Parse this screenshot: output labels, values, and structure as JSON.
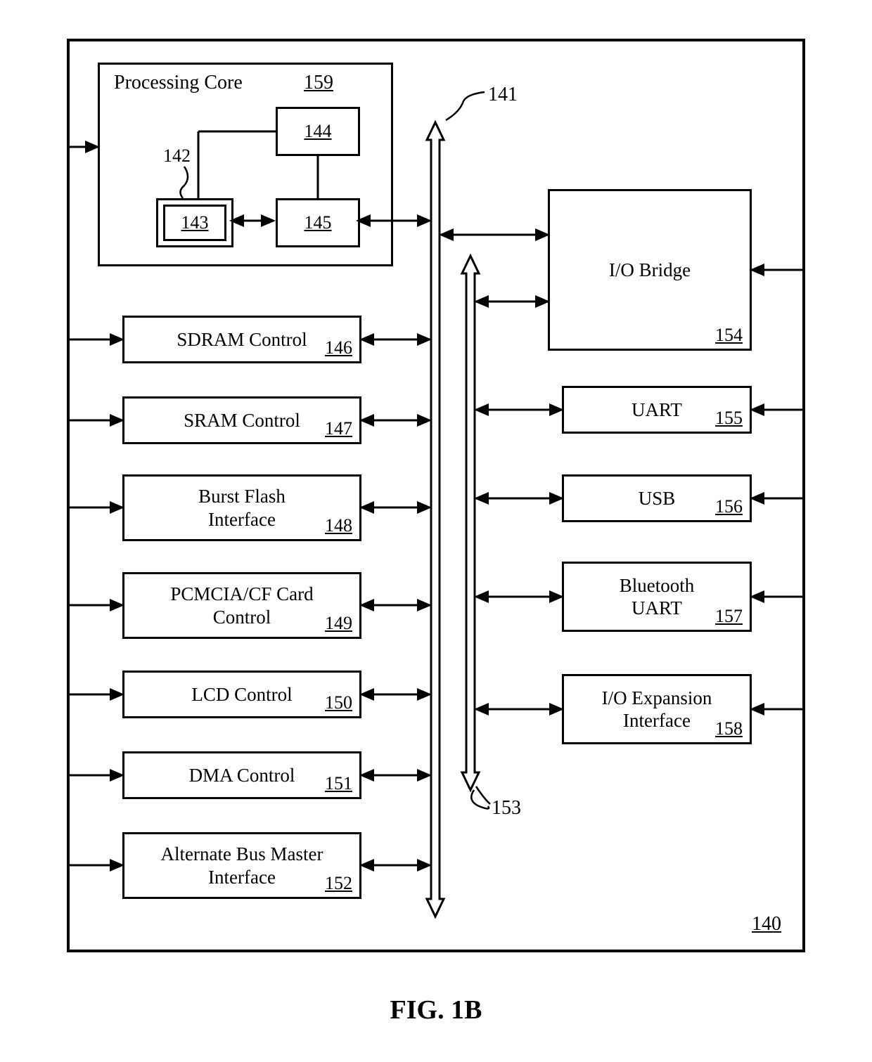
{
  "figure_label": "FIG. 1B",
  "outer_ref": "140",
  "processing_core": {
    "title": "Processing Core",
    "ref": "159",
    "box_144": "144",
    "box_145": "145",
    "box_143": "143",
    "label_142": "142"
  },
  "bus_labels": {
    "ref_141": "141",
    "ref_153": "153"
  },
  "left_blocks": [
    {
      "label": "SDRAM Control",
      "ref": "146"
    },
    {
      "label": "SRAM Control",
      "ref": "147"
    },
    {
      "label": "Burst Flash\nInterface",
      "ref": "148"
    },
    {
      "label": "PCMCIA/CF Card\nControl",
      "ref": "149"
    },
    {
      "label": "LCD Control",
      "ref": "150"
    },
    {
      "label": "DMA Control",
      "ref": "151"
    },
    {
      "label": "Alternate Bus Master\nInterface",
      "ref": "152"
    }
  ],
  "right_blocks": {
    "io_bridge": {
      "label": "I/O Bridge",
      "ref": "154"
    },
    "uart": {
      "label": "UART",
      "ref": "155"
    },
    "usb": {
      "label": "USB",
      "ref": "156"
    },
    "bt_uart": {
      "label": "Bluetooth\nUART",
      "ref": "157"
    },
    "io_exp": {
      "label": "I/O Expansion\nInterface",
      "ref": "158"
    }
  }
}
